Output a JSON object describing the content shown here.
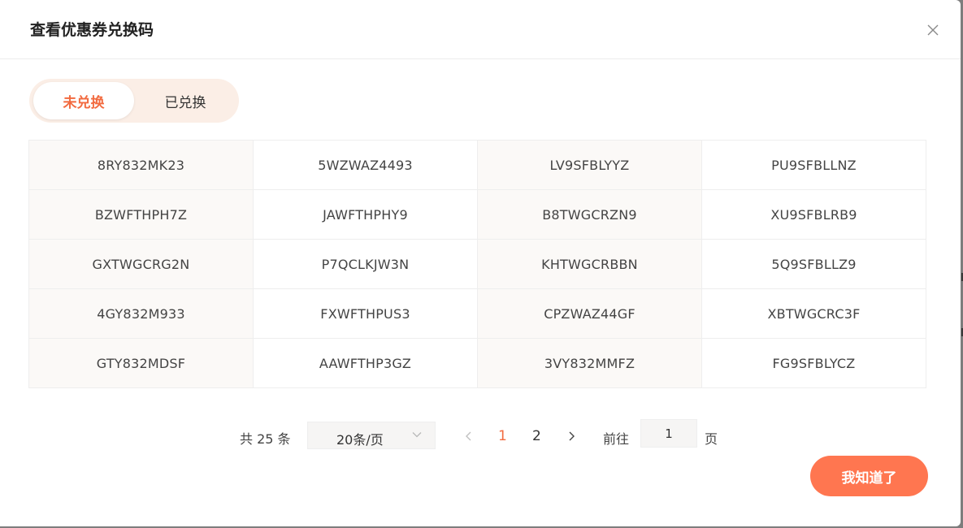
{
  "dialog": {
    "title": "查看优惠券兑换码"
  },
  "tabs": [
    {
      "label": "未兑换",
      "active": true
    },
    {
      "label": "已兑换",
      "active": false
    }
  ],
  "codes": [
    [
      "8RY832MK23",
      "5WZWAZ4493",
      "LV9SFBLYYZ",
      "PU9SFBLLNZ"
    ],
    [
      "BZWFTHPH7Z",
      "JAWFTHPHY9",
      "B8TWGCRZN9",
      "XU9SFBLRB9"
    ],
    [
      "GXTWGCRG2N",
      "P7QCLKJW3N",
      "KHTWGCRBBN",
      "5Q9SFBLLZ9"
    ],
    [
      "4GY832M933",
      "FXWFTHPUS3",
      "CPZWAZ44GF",
      "XBTWGCRC3F"
    ],
    [
      "GTY832MDSF",
      "AAWFTHP3GZ",
      "3VY832MMFZ",
      "FG9SFBLYCZ"
    ]
  ],
  "pagination": {
    "total_label": "共 25 条",
    "page_size_label": "20条/页",
    "pages": [
      "1",
      "2"
    ],
    "current_page": "1",
    "goto_label": "前往",
    "goto_value": "1",
    "goto_suffix": "页"
  },
  "confirm_button": "我知道了",
  "colors": {
    "accent": "#ff7650",
    "active_tab_text": "#f26b40",
    "tab_bar_bg": "#fbeee6"
  },
  "icons": {
    "close": "close-icon",
    "page_size_dropdown": "chevron-down-icon",
    "prev": "chevron-left-icon",
    "next": "chevron-right-icon"
  }
}
